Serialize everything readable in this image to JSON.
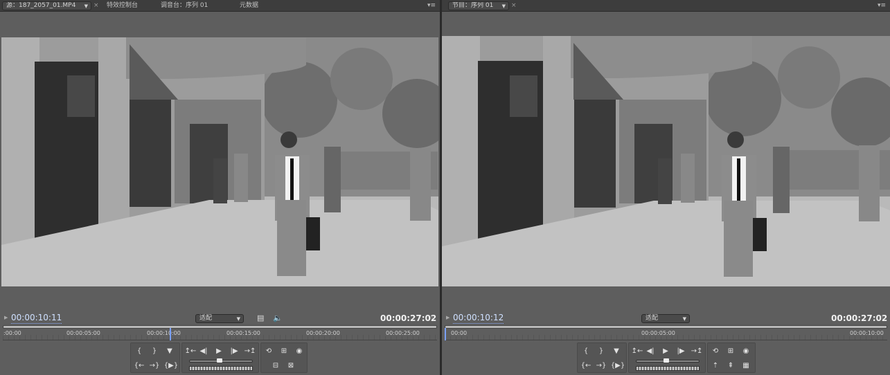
{
  "source_panel": {
    "source_dropdown": "源：187_2057_01.MP4",
    "tabs": [
      "特效控制台",
      "调音台：序列 01",
      "元数据"
    ],
    "current_timecode": "00:00:10:11",
    "fit_dropdown": "适配",
    "duration_timecode": "00:00:27:02",
    "ruler_ticks": [
      ":00:00",
      "00:00:05:00",
      "00:00:10:00",
      "00:00:15:00",
      "00:00:20:00",
      "00:00:25:00"
    ],
    "playhead_fraction": 0.385
  },
  "program_panel": {
    "sequence_dropdown": "节目：序列 01",
    "current_timecode": "00:00:10:12",
    "fit_dropdown": "适配",
    "duration_timecode": "00:00:27:02",
    "ruler_ticks": [
      "00:00",
      "00:00:05:00",
      "00:00:10:00"
    ],
    "playhead_fraction": 0.0
  },
  "icons": {
    "close": "close-icon",
    "panel_menu": "panel-menu-icon",
    "caret": "chevron-down-icon",
    "export_frame": "film-strip-icon",
    "audio": "speaker-icon"
  },
  "glyphs": {
    "close": "×",
    "menu": "▾≡",
    "caret": "▼",
    "pin": "▶",
    "grip": "⁞⁞",
    "film": "▤",
    "speaker": "🔈",
    "mark_in": "{",
    "mark_out": "}",
    "marker": "▼",
    "goto_in": "{←",
    "goto_out": "→}",
    "play_in_out": "{▶}",
    "step_back_edit": "↥←",
    "step_back": "◀|",
    "play": "▶",
    "step_forward": "|▶",
    "step_forward_edit": "→↥",
    "loop": "⟲",
    "safe_margins": "⊞",
    "output": "◉",
    "insert": "⊟",
    "overlay": "⊠",
    "lift": "⇡",
    "extract": "⇞",
    "trim": "▦"
  },
  "colors": {
    "panel_bg": "#5e5e5e",
    "tab_bg": "#3d3d3d",
    "timecode_blue": "#cfe0ff",
    "playhead": "#7aa0ff"
  }
}
